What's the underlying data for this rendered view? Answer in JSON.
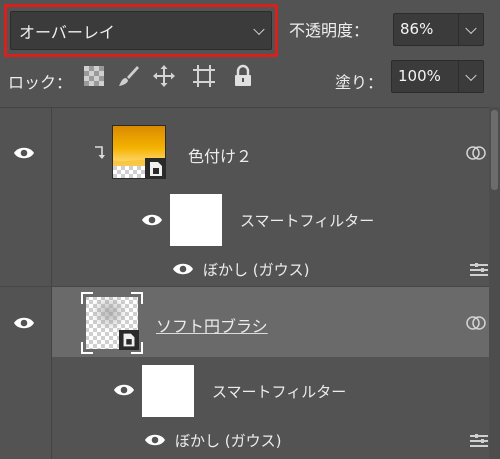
{
  "options_bar": {
    "blend_mode": "オーバーレイ",
    "opacity_label": "不透明度：",
    "opacity_value": "86%",
    "lock_label": "ロック：",
    "fill_label": "塗り：",
    "fill_value": "100%",
    "highlight_color": "#d8201d"
  },
  "layers": [
    {
      "name": "色付け２",
      "visible": true,
      "clipping_mask": true,
      "smart_object": true,
      "smart_filter_label": "スマートフィルター",
      "filter_name": "ぼかし (ガウス)"
    },
    {
      "name": "ソフト円ブラシ",
      "visible": true,
      "selected": true,
      "smart_object": true,
      "smart_filter_label": "スマートフィルター",
      "filter_name": "ぼかし (ガウス)"
    }
  ],
  "colors": {
    "panel_bg": "#535353",
    "selected_row": "#6a6a6a",
    "field_bg": "#3b3b3b",
    "thumb_gradient": [
      "#d98a00",
      "#f5b300"
    ]
  }
}
